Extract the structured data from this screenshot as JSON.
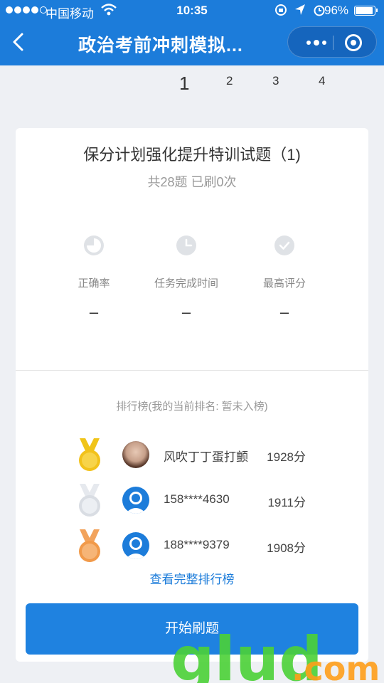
{
  "status_bar": {
    "carrier": "中国移动",
    "time": "10:35",
    "battery": "96%",
    "battery_level": 0.96
  },
  "nav": {
    "title": "政治考前冲刺模拟...",
    "back_icon": "chevron-left-icon",
    "more_icon": "more-dots-icon",
    "close_icon": "target-circle-icon"
  },
  "pager": {
    "pages": [
      "1",
      "2",
      "3",
      "4"
    ],
    "active": "1"
  },
  "exam": {
    "title": "保分计划强化提升特训试题（1)",
    "subtitle": "共28题 已刷0次"
  },
  "stats": [
    {
      "icon": "pie-chart-icon",
      "label": "正确率",
      "value": "–"
    },
    {
      "icon": "clock-icon",
      "label": "任务完成时间",
      "value": "–"
    },
    {
      "icon": "check-circle-icon",
      "label": "最高评分",
      "value": "–"
    }
  ],
  "leaderboard": {
    "title": "排行榜(我的当前排名: 暂未入榜)",
    "rows": [
      {
        "medal": "gold-medal-icon",
        "avatar": "user-photo",
        "name": "风吹丁丁蛋打颤",
        "score": "1928分"
      },
      {
        "medal": "silver-medal-icon",
        "avatar": "default-avatar-icon",
        "name": "158****4630",
        "score": "1911分"
      },
      {
        "medal": "bronze-medal-icon",
        "avatar": "default-avatar-icon",
        "name": "188****9379",
        "score": "1908分"
      }
    ],
    "view_all": "查看完整排行榜"
  },
  "start_button": "开始刷题",
  "colors": {
    "primary": "#1c7cda",
    "gold": "#f2c21b",
    "silver": "#d9dde3",
    "bronze": "#f19a4a",
    "watermark_green": "#4cd137",
    "watermark_orange": "#ff9f1a"
  }
}
